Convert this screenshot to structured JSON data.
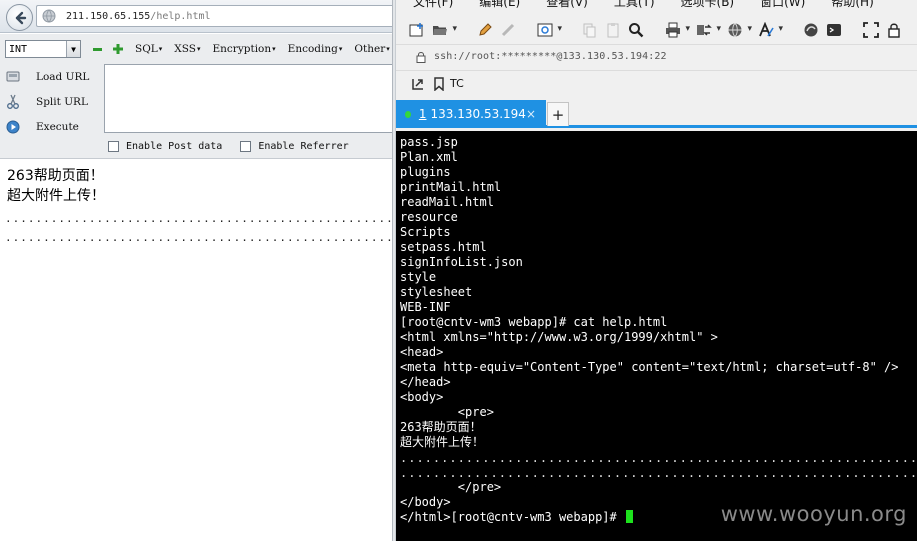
{
  "browser": {
    "url_host": "211.150.65.155",
    "url_path": "/help.html",
    "hackbar": {
      "select_value": "INT",
      "menus": [
        "SQL",
        "XSS",
        "Encryption",
        "Encoding",
        "Other"
      ],
      "load_url": "Load URL",
      "split_url": "Split URL",
      "execute": "Execute",
      "enable_post": "Enable Post data",
      "enable_referrer": "Enable Referrer"
    },
    "page": {
      "line1": "263帮助页面！",
      "line2": "超大附件上传！",
      "dots": "..............................................................................................................................."
    }
  },
  "ssh": {
    "menu": [
      "文件(F)",
      "编辑(E)",
      "查看(V)",
      "工具(T)",
      "选项卡(B)",
      "窗口(W)",
      "帮助(H)"
    ],
    "address": "ssh://root:*********@133.130.53.194:22",
    "bookmark_label": "TC",
    "tab": {
      "number": "1",
      "title": "133.130.53.194"
    },
    "terminal": {
      "lines": [
        "pass.jsp",
        "Plan.xml",
        "plugins",
        "printMail.html",
        "readMail.html",
        "resource",
        "Scripts",
        "setpass.html",
        "signInfoList.json",
        "style",
        "stylesheet",
        "WEB-INF",
        "[root@cntv-wm3 webapp]# cat help.html",
        "<html xmlns=\"http://www.w3.org/1999/xhtml\" >",
        "<head>",
        "<meta http-equiv=\"Content-Type\" content=\"text/html; charset=utf-8\" />",
        "</head>",
        "<body>",
        "        <pre>",
        "263帮助页面！",
        "超大附件上传！"
      ],
      "after_lines": [
        "        </pre>",
        "</body>",
        "</html>[root@cntv-wm3 webapp]# "
      ],
      "dots": "..........................................................................................................................................."
    },
    "watermark": "www.wooyun.org"
  }
}
